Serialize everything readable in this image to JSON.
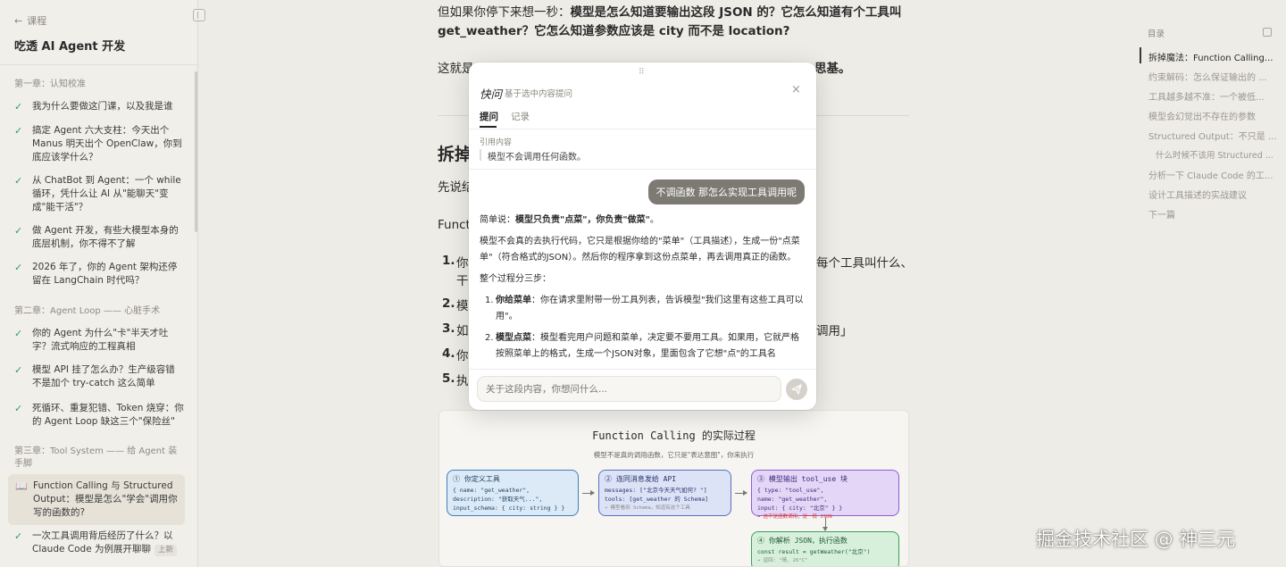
{
  "sidebar": {
    "back_label": "课程",
    "course_title": "吃透 AI Agent 开发",
    "chapter1": "第一章：认知校准",
    "ch1": [
      "我为什么要做这门课，以及我是谁",
      "搞定 Agent 六大支柱：今天出个 Manus 明天出个 OpenClaw，你到底应该学什么？",
      "从 ChatBot 到 Agent：一个 while 循环，凭什么让 AI 从\"能聊天\"变成\"能干活\"？",
      "做 Agent 开发，有些大模型本身的底层机制，你不得不了解",
      "2026 年了，你的 Agent 架构还停留在 LangChain 时代吗？"
    ],
    "chapter2": "第二章：Agent Loop —— 心脏手术",
    "ch2": [
      "你的 Agent 为什么\"卡\"半天才吐字？流式响应的工程真相",
      "模型 API 挂了怎么办？生产级容错不是加个 try-catch 这么简单",
      "死循环、重复犯错、Token 烧穿：你的 Agent Loop 缺这三个\"保险丝\""
    ],
    "chapter3": "第三章：Tool System —— 给 Agent 装手脚",
    "active_lesson": "Function Calling 与 Structured Output：模型是怎么\"学会\"调用你写的函数的?",
    "last_lesson": "一次工具调用背后经历了什么？以 Claude Code 为例展开聊聊",
    "last_tag": "上新"
  },
  "article": {
    "p1_a": "但如果你停下来想一秒：",
    "p1_b": "模型是怎么知道要输出这段 JSON 的？它怎么知道有个工具叫",
    "p1_c": "get_weather？它怎么知道参数应该是 city 而不是 location?",
    "p2_start": "这就是",
    "p2_end": "思基。",
    "h2_start": "拆掉",
    "p3_start": "先说结",
    "p4_start": "Funct",
    "li1_start": "你",
    "li1_end": "每个工具叫什么、",
    "li1_line2": "干",
    "li2_start": "模",
    "li3_start": "如",
    "li3_end": "调用」",
    "li4_start": "你",
    "li5_start": "执",
    "n1": "1.",
    "n2": "2.",
    "n3": "3.",
    "n4": "4.",
    "n5": "5."
  },
  "diagram": {
    "title": "Function Calling 的实际过程",
    "subtitle": "模型不是真的调用函数，它只是\"表达意图\"，你来执行",
    "box1_title": "① 你定义工具",
    "box1_l1": "{ name: \"get_weather\",",
    "box1_l2": "  description: \"获取天气...\",",
    "box1_l3": "  input_schema: { city: string } }",
    "box2_title": "② 连同消息发给 API",
    "box2_l1": "messages: [\"北京今天天气如何? \"]",
    "box2_l2": "tools: [get_weather 的 Schema]",
    "box2_note": "→ 模型看到 Schema，知道有这个工具",
    "box3_title": "③ 模型输出 tool_use 块",
    "box3_l1": "{ type: \"tool_use\",",
    "box3_l2": "  name: \"get_weather\",",
    "box3_l3": "  input: { city: \"北京\" } }",
    "box3_note": "→ 这不是函数调用，是一段 JSON",
    "box4_title": "④ 你解析 JSON，执行函数",
    "box4_l1": "const result = getWeather(\"北京\")",
    "box4_note": "→ 返回: \"晴, 26°C\""
  },
  "toc": {
    "title": "目录",
    "items": [
      "拆掉魔法：Function Calling...",
      "约束解码：怎么保证输出的 ...",
      "工具越多越不准：一个被低...",
      "模型会幻觉出不存在的参数",
      "Structured Output：不只是 ...",
      "什么时候不该用 Structured ...",
      "分析一下 Claude Code 的工...",
      "设计工具描述的实战建议",
      "下一篇"
    ]
  },
  "popup": {
    "logo": "快问",
    "subtitle": "基于选中内容提问",
    "close": "×",
    "tab_ask": "提问",
    "tab_history": "记录",
    "quote_label": "引用内容",
    "quote_text": "模型不会调用任何函数。",
    "user_message": "不调函数 那怎么实现工具调用呢",
    "a_intro": "简单说：",
    "a_intro_bold": "模型只负责\"点菜\"，你负责\"做菜\"",
    "a_intro_end": "。",
    "a_p2": "模型不会真的去执行代码，它只是根据你给的\"菜单\"（工具描述），生成一份\"点菜单\"（符合格式的JSON）。然后你的程序拿到这份点菜单，再去调用真正的函数。",
    "a_p3": "整个过程分三步：",
    "s1_n": "1.",
    "s1_bold": "你给菜单",
    "s1_text": "：你在请求里附带一份工具列表，告诉模型\"我们这里有这些工具可以用\"。",
    "s2_n": "2.",
    "s2_bold": "模型点菜",
    "s2_text": "：模型看完用户问题和菜单，决定要不要用工具。如果用，它就严格按照菜单上的格式，生成一个JSON对象，里面包含了它想\"点\"的工具名",
    "placeholder": "关于这段内容，你想问什么..."
  },
  "watermark": "掘金技术社区 @ 神三元"
}
